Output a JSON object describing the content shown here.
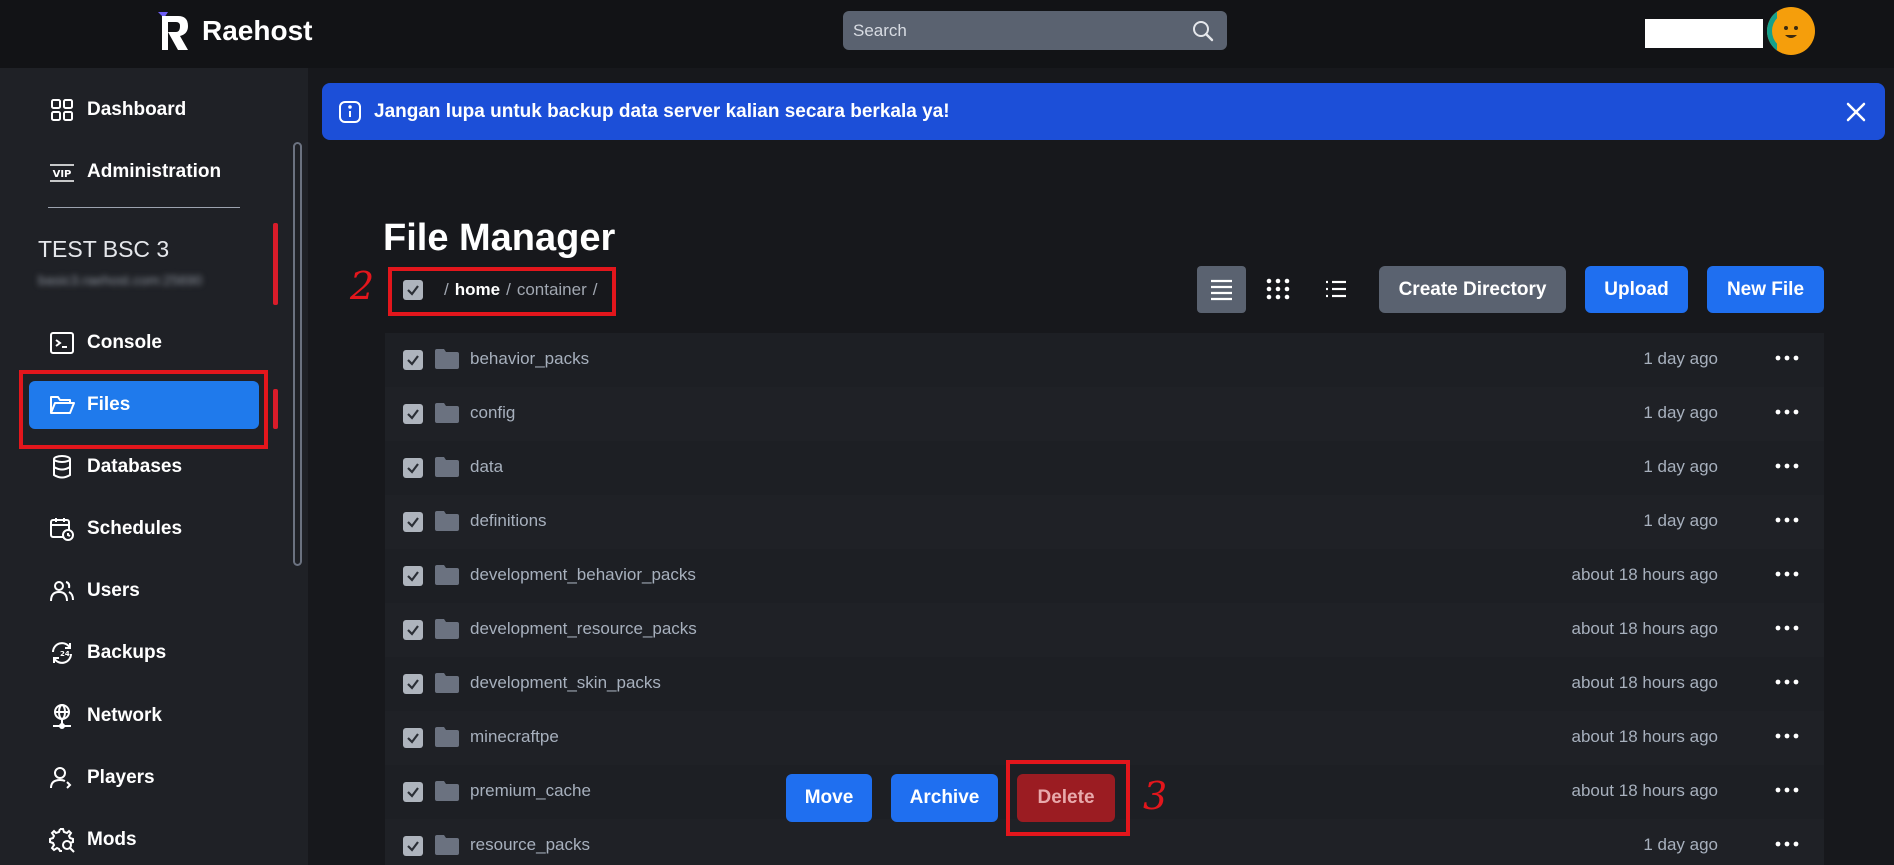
{
  "brand": {
    "name": "Raehost"
  },
  "search": {
    "placeholder": "Search"
  },
  "sidebar": {
    "top_items": [
      {
        "label": "Dashboard",
        "icon": "grid-icon"
      },
      {
        "label": "Administration",
        "icon": "vip-icon"
      }
    ],
    "server": {
      "name": "TEST BSC 3",
      "host": "basic3.raehost.com:25690"
    },
    "items": [
      {
        "label": "Console",
        "icon": "terminal-icon"
      },
      {
        "label": "Files",
        "icon": "folder-open-icon",
        "active": true
      },
      {
        "label": "Databases",
        "icon": "database-icon"
      },
      {
        "label": "Schedules",
        "icon": "calendar-clock-icon"
      },
      {
        "label": "Users",
        "icon": "users-icon"
      },
      {
        "label": "Backups",
        "icon": "backup-icon"
      },
      {
        "label": "Network",
        "icon": "network-icon"
      },
      {
        "label": "Players",
        "icon": "player-icon"
      },
      {
        "label": "Mods",
        "icon": "gear-search-icon"
      }
    ]
  },
  "alert": {
    "text": "Jangan lupa untuk backup data server kalian secara berkala ya!"
  },
  "file_manager": {
    "title": "File Manager",
    "breadcrumb": {
      "sep1": "/",
      "home": "home",
      "sep2": "/",
      "container": "container",
      "sep3": "/"
    },
    "buttons": {
      "create_directory": "Create Directory",
      "upload": "Upload",
      "new_file": "New File"
    },
    "files": [
      {
        "name": "behavior_packs",
        "modified": "1 day ago"
      },
      {
        "name": "config",
        "modified": "1 day ago"
      },
      {
        "name": "data",
        "modified": "1 day ago"
      },
      {
        "name": "definitions",
        "modified": "1 day ago"
      },
      {
        "name": "development_behavior_packs",
        "modified": "about 18 hours ago"
      },
      {
        "name": "development_resource_packs",
        "modified": "about 18 hours ago"
      },
      {
        "name": "development_skin_packs",
        "modified": "about 18 hours ago"
      },
      {
        "name": "minecraftpe",
        "modified": "about 18 hours ago"
      },
      {
        "name": "premium_cache",
        "modified": "about 18 hours ago"
      },
      {
        "name": "resource_packs",
        "modified": "1 day ago"
      }
    ],
    "mass_actions": {
      "move": "Move",
      "archive": "Archive",
      "delete": "Delete"
    }
  },
  "annotations": {
    "step2": "2",
    "step3": "3"
  },
  "colors": {
    "accent": "#1f6ff0",
    "alert": "#1c4fd8",
    "annotation": "#e3161c",
    "danger": "#9b1c22"
  }
}
